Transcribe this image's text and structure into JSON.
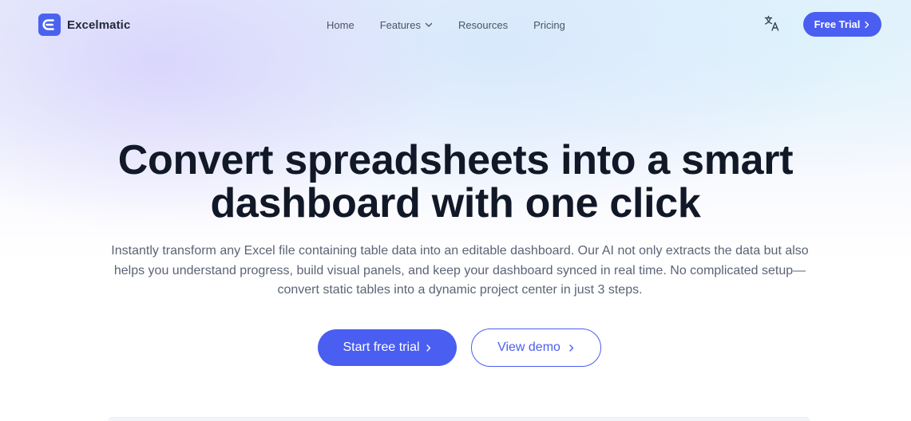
{
  "brand": {
    "name": "Excelmatic",
    "logo_icon": "excel-e-logo-icon",
    "logo_color": "#4a63ee"
  },
  "nav": {
    "items": [
      {
        "label": "Home"
      },
      {
        "label": "Features",
        "has_dropdown": true
      },
      {
        "label": "Resources"
      },
      {
        "label": "Pricing"
      }
    ]
  },
  "header": {
    "language_icon": "translate-icon",
    "trial_button_label": "Free Trial"
  },
  "hero": {
    "title_line1": "Convert spreadsheets into a smart",
    "title_line2": "dashboard with one click",
    "subtitle": "Instantly transform any Excel file containing table data into an editable dashboard. Our AI not only extracts the data but also helps you understand progress, build visual panels, and keep your dashboard synced in real time. No complicated setup—convert static tables into a dynamic project center in just 3 steps.",
    "primary_cta": "Start free trial",
    "secondary_cta": "View demo"
  },
  "colors": {
    "accent": "#4a5ef2",
    "text_dark": "#111827",
    "text_muted": "#5b6475"
  }
}
